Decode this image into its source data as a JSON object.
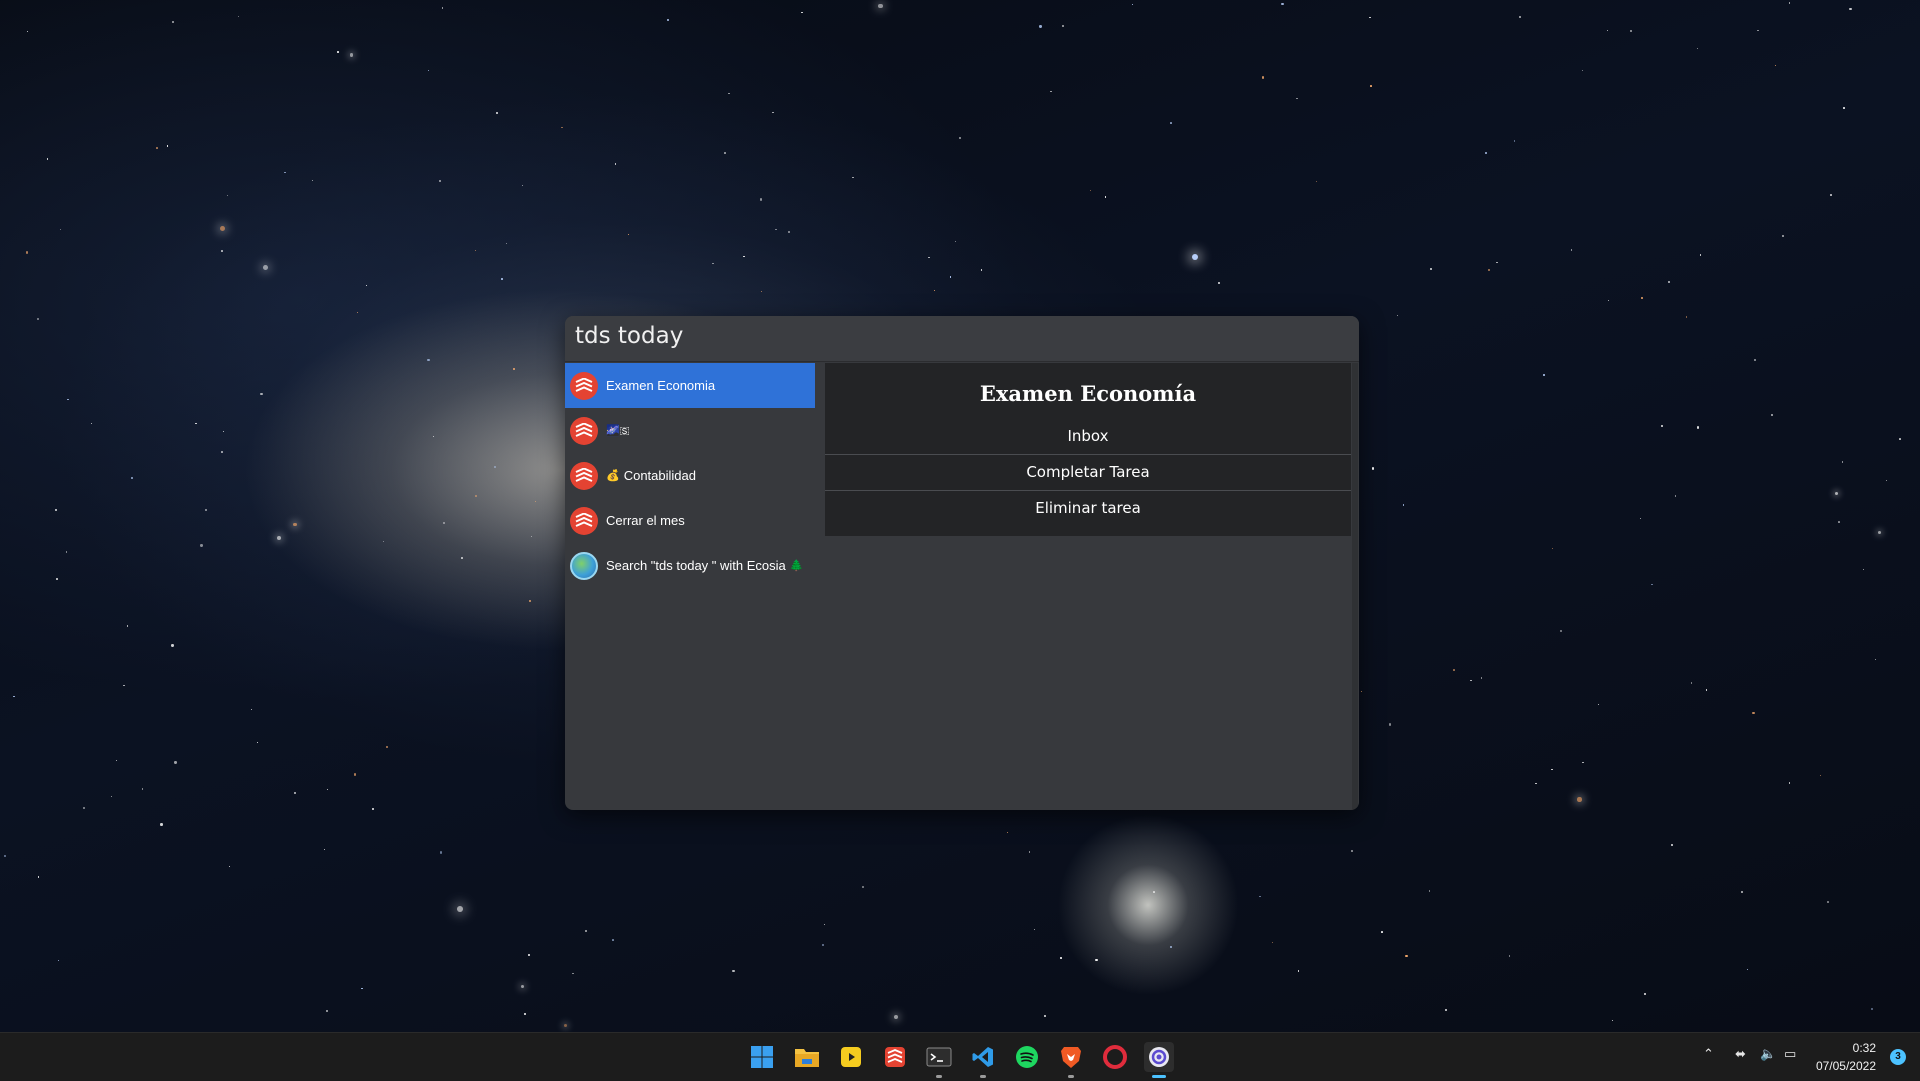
{
  "launcher": {
    "query": "tds today",
    "results": [
      {
        "label": "Examen Economia",
        "emoji": "",
        "icon": "todoist-icon",
        "selected": true
      },
      {
        "label": "",
        "emoji": "🌌🇸",
        "icon": "todoist-icon",
        "selected": false
      },
      {
        "label": "Contabilidad",
        "emoji": "💰",
        "icon": "todoist-icon",
        "selected": false
      },
      {
        "label": "Cerrar el mes",
        "emoji": "",
        "icon": "todoist-icon",
        "selected": false
      },
      {
        "label": "Search \"tds today \" with Ecosia",
        "emoji_after": "🌲",
        "icon": "ecosia-icon",
        "selected": false
      }
    ],
    "detail": {
      "title": "Examen Economía",
      "project": "Inbox",
      "actions": [
        "Completar Tarea",
        "Eliminar tarea"
      ]
    }
  },
  "taskbar": {
    "apps": [
      "windows-start-icon",
      "file-explorer-icon",
      "sticky-app-icon",
      "todoist-icon",
      "terminal-icon",
      "vscode-icon",
      "spotify-icon",
      "brave-icon",
      "opera-icon",
      "launcher-app-icon"
    ],
    "clock_time": "0:32",
    "clock_date": "07/05/2022",
    "notification_count": "3"
  },
  "colors": {
    "accent": "#2f72d8",
    "todoist_red": "#e44332",
    "window_bg": "#37393d",
    "panel_bg": "#232426"
  }
}
